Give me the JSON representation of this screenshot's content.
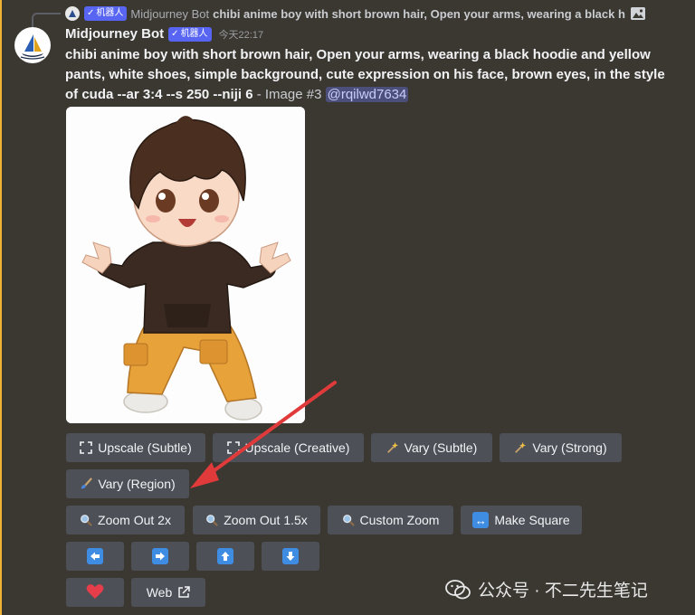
{
  "reply": {
    "badge": "机器人",
    "name": "Midjourney Bot",
    "text": "chibi anime boy with short brown hair, Open your arms, wearing a black h"
  },
  "message": {
    "author": "Midjourney Bot",
    "badge": "机器人",
    "timestamp": "今天22:17",
    "prompt": "chibi anime boy with short brown hair, Open your arms, wearing a black hoodie and yellow pants, white shoes, simple background, cute expression on his face, brown eyes, in the style of cuda --ar 3:4 --s 250 --niji 6",
    "suffix": " - Image #3 ",
    "mention": "@rqilwd7634"
  },
  "buttons": {
    "upscale_subtle": "Upscale (Subtle)",
    "upscale_creative": "Upscale (Creative)",
    "vary_subtle": "Vary (Subtle)",
    "vary_strong": "Vary (Strong)",
    "vary_region": "Vary (Region)",
    "zoom_out_2x": "Zoom Out 2x",
    "zoom_out_15x": "Zoom Out 1.5x",
    "custom_zoom": "Custom Zoom",
    "make_square": "Make Square",
    "web": "Web"
  },
  "watermark": "公众号 · 不二先生笔记",
  "colors": {
    "background": "#3b3832",
    "button": "#4e5058",
    "badge": "#5865f2",
    "highlight_bar": "#f0b232",
    "arrow_button": "#3f8ce3",
    "annotation_arrow": "#e03a3a",
    "heart": "#e53d4a"
  },
  "icons": {
    "upscale": "expand-arrows-icon",
    "vary": "sparkle-wand-icon",
    "vary_region": "paintbrush-icon",
    "zoom": "magnifier-icon",
    "make_square": "left-right-arrow-icon",
    "pan": [
      "arrow-left-icon",
      "arrow-right-icon",
      "arrow-up-icon",
      "arrow-down-icon"
    ],
    "like": "heart-icon",
    "web": "external-link-icon"
  }
}
